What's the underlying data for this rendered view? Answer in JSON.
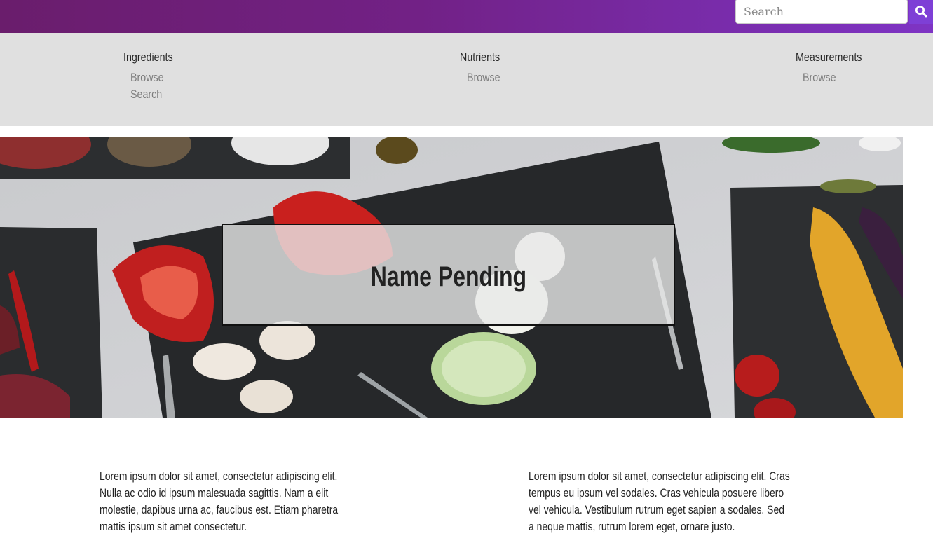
{
  "header": {
    "search_placeholder": "Search",
    "search_icon": "search-icon"
  },
  "nav": {
    "columns": [
      {
        "heading": "Ingredients",
        "links": [
          "Browse",
          "Search"
        ]
      },
      {
        "heading": "Nutrients",
        "links": [
          "Browse"
        ]
      },
      {
        "heading": "Measurements",
        "links": [
          "Browse"
        ]
      }
    ]
  },
  "hero": {
    "title": "Name Pending",
    "image": "vegetables-on-slate-boards"
  },
  "content": {
    "paragraphs": [
      "Lorem ipsum dolor sit amet, consectetur adipiscing elit. Nulla ac odio id ipsum malesuada sagittis. Nam a elit molestie, dapibus urna ac, faucibus est. Etiam pharetra mattis ipsum sit amet consectetur.",
      "Lorem ipsum dolor sit amet, consectetur adipiscing elit. Cras tempus eu ipsum vel sodales. Cras vehicula posuere libero vel vehicula. Vestibulum rutrum eget sapien a sodales. Sed a neque mattis, rutrum lorem eget, ornare justo."
    ]
  },
  "colors": {
    "topbar_start": "#6a1d6c",
    "topbar_end": "#7e34c4",
    "nav_background": "#e0e0e0",
    "nav_link": "#7c7c7c"
  }
}
